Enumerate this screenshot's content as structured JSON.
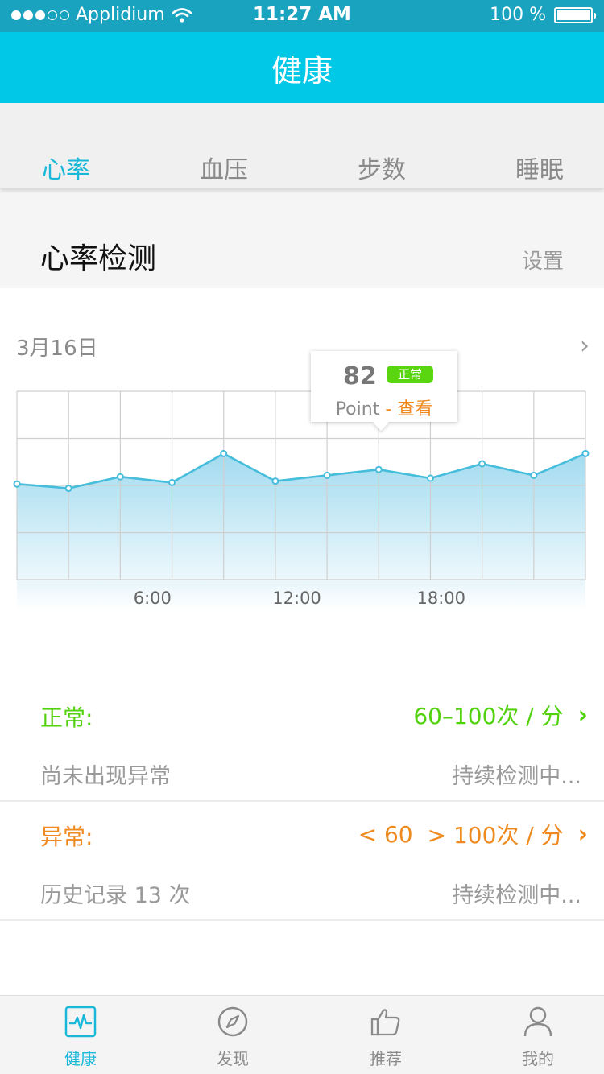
{
  "status_bar": {
    "carrier": "Applidium",
    "time": "11:27 AM",
    "battery": "100 %",
    "signal_filled": 3,
    "signal_total": 5,
    "battery_level": 1.0
  },
  "nav": {
    "title": "健康"
  },
  "tabs": [
    {
      "label": "心率",
      "active": true
    },
    {
      "label": "血压",
      "active": false
    },
    {
      "label": "步数",
      "active": false
    },
    {
      "label": "睡眠",
      "active": false
    }
  ],
  "section": {
    "title": "心率检测",
    "settings": "设置"
  },
  "chart": {
    "date": "3月16日",
    "tooltip": {
      "value": "82",
      "badge": "正常",
      "point_label": "Point",
      "separator": " - ",
      "view_link": "查看"
    }
  },
  "chart_data": {
    "type": "area",
    "x_tick_labels": [
      "6:00",
      "12:00",
      "18:00"
    ],
    "values": [
      66,
      63,
      71,
      67,
      87,
      68,
      72,
      76,
      70,
      80,
      72,
      87
    ],
    "ylim": [
      0,
      130
    ],
    "grid": true,
    "colors": {
      "line": "#47bddc",
      "fill_top": "#9dd9ee",
      "fill_bottom": "#eaf7fc",
      "grid": "#cfcfcf"
    }
  },
  "normal": {
    "label": "正常:",
    "range": "60–100次 / 分",
    "status": "尚未出现异常",
    "detecting": "持续检测中..."
  },
  "abnormal": {
    "label": "异常:",
    "range_low": "< 60",
    "range_high": "> 100次 / 分",
    "history": "历史记录 13 次",
    "detecting": "持续检测中..."
  },
  "tab_bar": [
    {
      "label": "健康",
      "icon": "heartbeat-monitor-icon",
      "active": true
    },
    {
      "label": "发现",
      "icon": "compass-icon",
      "active": false
    },
    {
      "label": "推荐",
      "icon": "thumbs-up-icon",
      "active": false
    },
    {
      "label": "我的",
      "icon": "user-icon",
      "active": false
    }
  ],
  "colors": {
    "status_bar": "#1aa3bf",
    "nav_bar": "#00c8e6",
    "accent": "#19b8d8",
    "normal": "#52d10d",
    "abnormal": "#ee8a1f"
  }
}
